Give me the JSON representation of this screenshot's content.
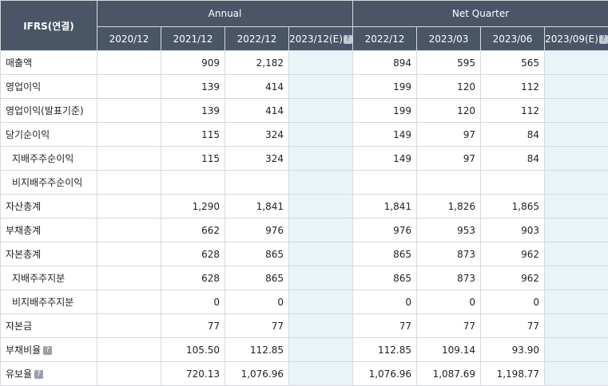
{
  "header": {
    "corner": "IFRS(연결)",
    "annual": "Annual",
    "quarter": "Net Quarter",
    "periods": [
      "2020/12",
      "2021/12",
      "2022/12",
      "2023/12(E)",
      "2022/12",
      "2023/03",
      "2023/06",
      "2023/09(E)"
    ],
    "help_icon": "?"
  },
  "rows": [
    {
      "label": "매출액",
      "values": [
        "",
        "909",
        "2,182",
        "",
        "894",
        "595",
        "565",
        ""
      ]
    },
    {
      "label": "영업이익",
      "values": [
        "",
        "139",
        "414",
        "",
        "199",
        "120",
        "112",
        ""
      ]
    },
    {
      "label": "영업이익(발표기준)",
      "values": [
        "",
        "139",
        "414",
        "",
        "199",
        "120",
        "112",
        ""
      ]
    },
    {
      "label": "당기순이익",
      "values": [
        "",
        "115",
        "324",
        "",
        "149",
        "97",
        "84",
        ""
      ]
    },
    {
      "label": "지배주주순이익",
      "values": [
        "",
        "115",
        "324",
        "",
        "149",
        "97",
        "84",
        ""
      ]
    },
    {
      "label": "비지배주주순이익",
      "values": [
        "",
        "",
        "",
        "",
        "",
        "",
        "",
        ""
      ]
    },
    {
      "label": "자산총계",
      "values": [
        "",
        "1,290",
        "1,841",
        "",
        "1,841",
        "1,826",
        "1,865",
        ""
      ]
    },
    {
      "label": "부채총계",
      "values": [
        "",
        "662",
        "976",
        "",
        "976",
        "953",
        "903",
        ""
      ]
    },
    {
      "label": "자본총계",
      "values": [
        "",
        "628",
        "865",
        "",
        "865",
        "873",
        "962",
        ""
      ]
    },
    {
      "label": "지배주주지분",
      "values": [
        "",
        "628",
        "865",
        "",
        "865",
        "873",
        "962",
        ""
      ]
    },
    {
      "label": "비지배주주지분",
      "values": [
        "",
        "0",
        "0",
        "",
        "0",
        "0",
        "0",
        ""
      ]
    },
    {
      "label": "자본금",
      "values": [
        "",
        "77",
        "77",
        "",
        "77",
        "77",
        "77",
        ""
      ]
    },
    {
      "label": "부채비율",
      "values": [
        "",
        "105.50",
        "112.85",
        "",
        "112.85",
        "109.14",
        "93.90",
        ""
      ]
    },
    {
      "label": "유보율",
      "values": [
        "",
        "720.13",
        "1,076.96",
        "",
        "1,076.96",
        "1,087.69",
        "1,198.77",
        ""
      ]
    }
  ]
}
